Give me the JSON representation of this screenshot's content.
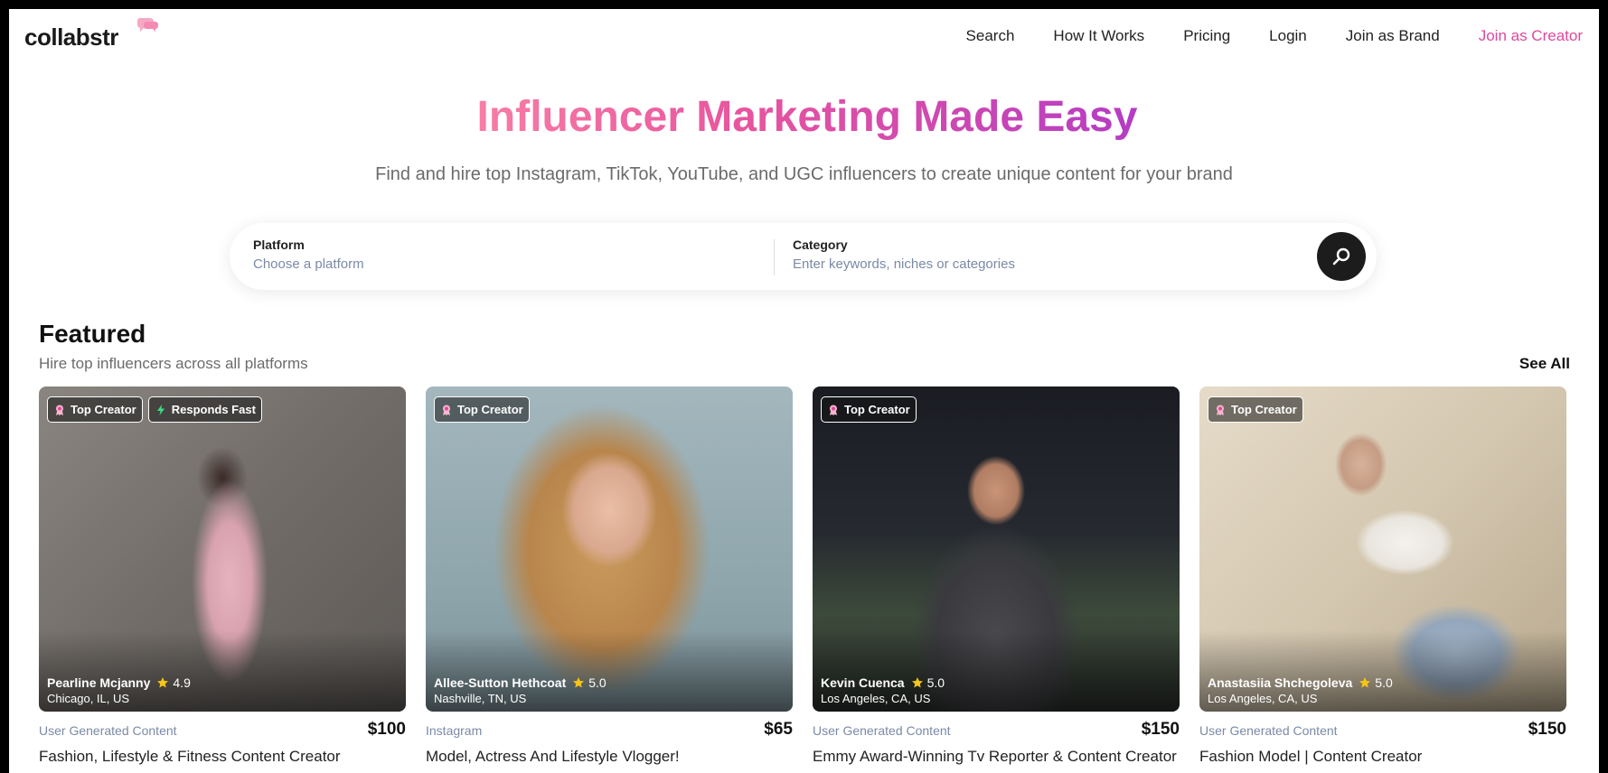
{
  "nav": {
    "logo": "collabstr",
    "links": [
      "Search",
      "How It Works",
      "Pricing",
      "Login",
      "Join as Brand",
      "Join as Creator"
    ]
  },
  "hero": {
    "title": "Influencer Marketing Made Easy",
    "subtitle": "Find and hire top Instagram, TikTok, YouTube, and UGC influencers to create unique content for your brand"
  },
  "search": {
    "platform_label": "Platform",
    "platform_placeholder": "Choose a platform",
    "category_label": "Category",
    "category_placeholder": "Enter keywords, niches or categories",
    "icon": "search-icon"
  },
  "featured": {
    "title": "Featured",
    "subtitle": "Hire top influencers across all platforms",
    "see_all": "See All",
    "cards": [
      {
        "badges": [
          "Top Creator",
          "Responds Fast"
        ],
        "name": "Pearline Mcjanny",
        "rating": "4.9",
        "location": "Chicago, IL, US",
        "category": "User Generated Content",
        "price": "$100",
        "title": "Fashion, Lifestyle & Fitness Content Creator"
      },
      {
        "badges": [
          "Top Creator"
        ],
        "name": "Allee-Sutton Hethcoat",
        "rating": "5.0",
        "location": "Nashville, TN, US",
        "category": "Instagram",
        "price": "$65",
        "title": "Model, Actress And Lifestyle Vlogger!"
      },
      {
        "badges": [
          "Top Creator"
        ],
        "name": "Kevin Cuenca",
        "rating": "5.0",
        "location": "Los Angeles, CA, US",
        "category": "User Generated Content",
        "price": "$150",
        "title": "Emmy Award-Winning Tv Reporter & Content Creator"
      },
      {
        "badges": [
          "Top Creator"
        ],
        "name": "Anastasiia Shchegoleva",
        "rating": "5.0",
        "location": "Los Angeles, CA, US",
        "category": "User Generated Content",
        "price": "$150",
        "title": "Fashion Model | Content Creator"
      }
    ]
  },
  "colors": {
    "accent_pink": "#e0489b",
    "gradient_start": "#f87ea6",
    "gradient_end": "#b43cc4",
    "muted_blue": "#7a8aa6"
  }
}
